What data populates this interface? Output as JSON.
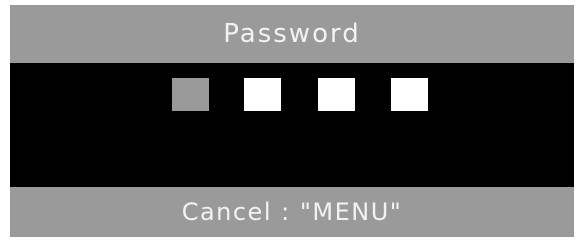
{
  "dialog": {
    "title": "Password",
    "cancel_hint": "Cancel : \"MENU\"",
    "digits": [
      {
        "state": "active",
        "color": "#999999"
      },
      {
        "state": "empty",
        "color": "#ffffff"
      },
      {
        "state": "empty",
        "color": "#ffffff"
      },
      {
        "state": "empty",
        "color": "#ffffff"
      }
    ]
  },
  "colors": {
    "frame": "#9a9a9a",
    "panel": "#000000",
    "text": "#f2f2f2"
  }
}
